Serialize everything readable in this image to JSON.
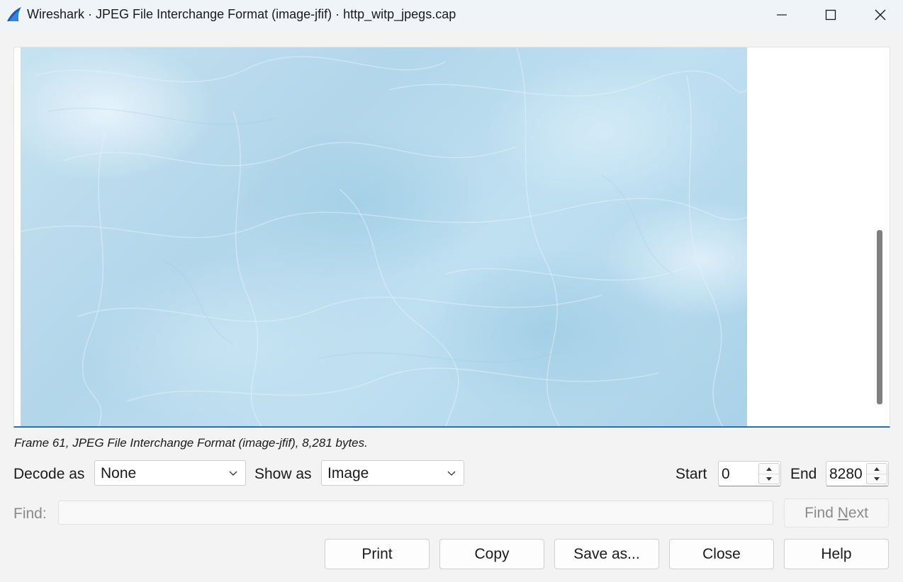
{
  "window": {
    "title": "Wireshark · JPEG File Interchange Format (image-jfif) · http_witp_jpegs.cap",
    "app_icon": "wireshark-fin-icon",
    "accent_color": "#2e6ea6"
  },
  "viewer": {
    "content": "decoded JPEG image (light blue textured)",
    "status_line": "Frame 61, JPEG File Interchange Format (image-jfif), 8,281 bytes."
  },
  "controls": {
    "decode_as_label": "Decode as",
    "decode_as_value": "None",
    "show_as_label": "Show as",
    "show_as_value": "Image",
    "start_label": "Start",
    "start_value": "0",
    "end_label": "End",
    "end_value": "8280"
  },
  "find": {
    "label": "Find:",
    "value": "",
    "find_next_pre": "Find ",
    "find_next_mnemonic": "N",
    "find_next_post": "ext"
  },
  "buttons": {
    "print": "Print",
    "copy": "Copy",
    "save_as": "Save as...",
    "close": "Close",
    "help": "Help"
  }
}
